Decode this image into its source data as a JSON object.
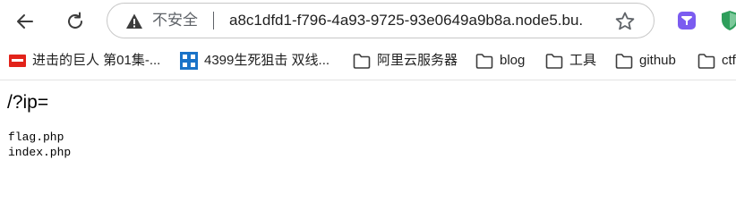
{
  "browser": {
    "security_label": "不安全",
    "url": "a8c1dfd1-f796-4a93-9725-93e0649a9b8a.node5.bu..."
  },
  "bookmarks": [
    {
      "label": "进击的巨人 第01集-...",
      "icon": "tv-favicon"
    },
    {
      "label": "4399生死狙击 双线...",
      "icon": "4399-favicon"
    },
    {
      "label": "阿里云服务器",
      "icon": "folder-icon"
    },
    {
      "label": "blog",
      "icon": "folder-icon"
    },
    {
      "label": "工具",
      "icon": "folder-icon"
    },
    {
      "label": "github",
      "icon": "folder-icon"
    },
    {
      "label": "ctf",
      "icon": "folder-icon"
    }
  ],
  "page": {
    "heading": "/?ip=",
    "files": [
      "flag.php",
      "index.php"
    ]
  },
  "colors": {
    "extension_purple": "#7b5cf0",
    "extension_green": "#2e9e5b",
    "bookmark_red": "#e2231a",
    "bookmark_blue": "#1a73c8"
  }
}
